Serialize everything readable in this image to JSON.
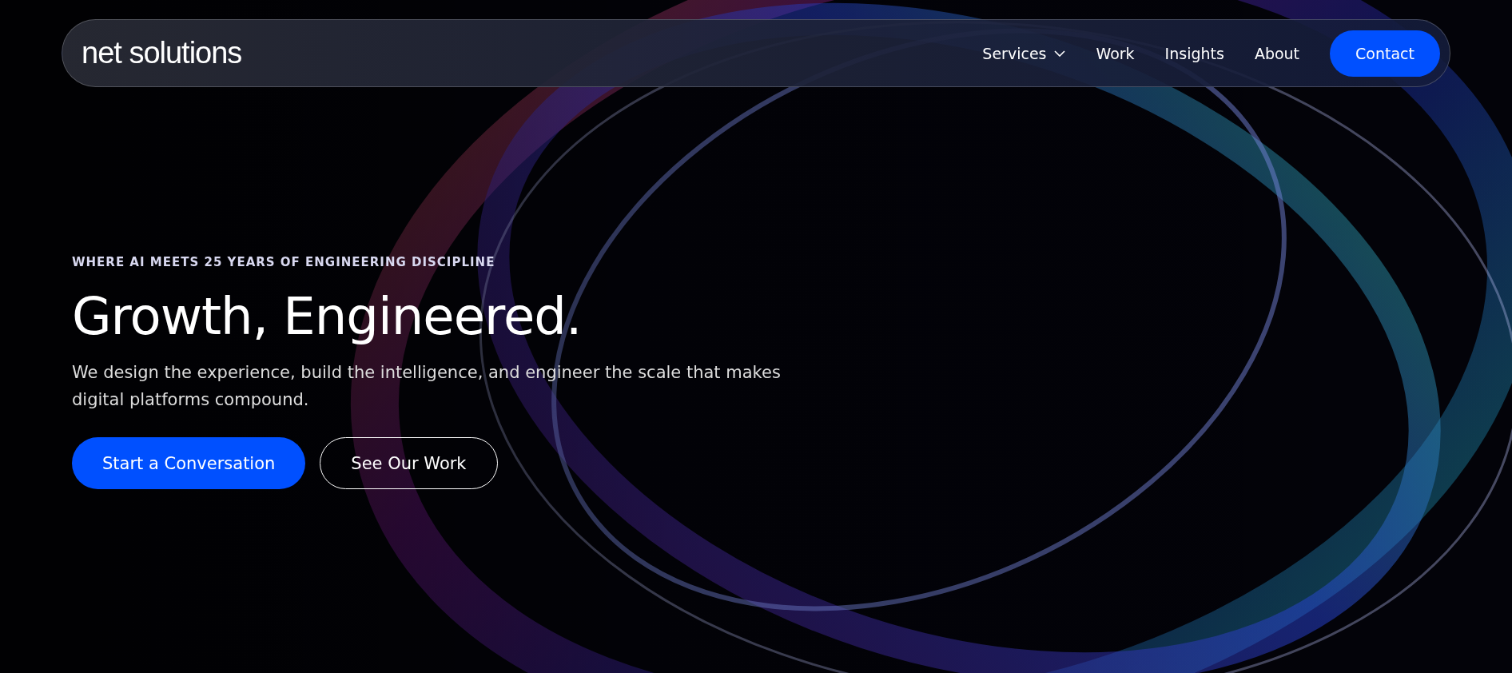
{
  "header": {
    "logo": "net solutions",
    "nav": [
      {
        "label": "Services",
        "has_dropdown": true
      },
      {
        "label": "Work",
        "has_dropdown": false
      },
      {
        "label": "Insights",
        "has_dropdown": false
      },
      {
        "label": "About",
        "has_dropdown": false
      }
    ],
    "cta": "Contact"
  },
  "hero": {
    "eyebrow": "WHERE AI MEETS 25 YEARS OF ENGINEERING DISCIPLINE",
    "title": "Growth, Engineered.",
    "description": "We design the experience, build the intelligence, and engineer the scale that makes digital platforms compound.",
    "buttons": [
      {
        "label": "Start a Conversation",
        "kind": "primary"
      },
      {
        "label": "See Our Work",
        "kind": "outline"
      }
    ]
  }
}
